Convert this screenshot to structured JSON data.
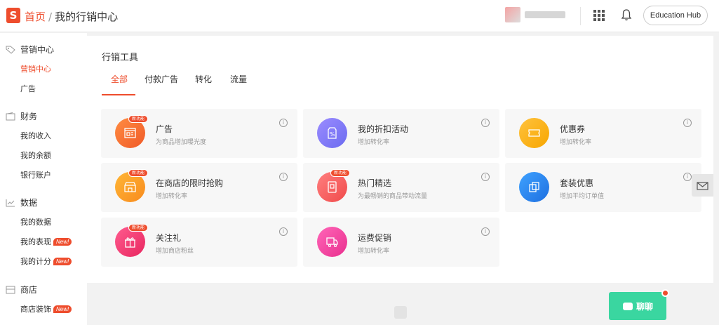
{
  "header": {
    "logo_letter": "S",
    "breadcrumb_home": "首页",
    "breadcrumb_sep": "/",
    "breadcrumb_current": "我的行销中心",
    "edu_hub_label": "Education Hub"
  },
  "sidebar": {
    "sections": [
      {
        "title": "营销中心",
        "icon": "tag-icon",
        "items": [
          {
            "label": "营销中心",
            "active": true
          },
          {
            "label": "广告"
          }
        ]
      },
      {
        "title": "财务",
        "icon": "wallet-icon",
        "items": [
          {
            "label": "我的收入"
          },
          {
            "label": "我的余额"
          },
          {
            "label": "银行账户"
          }
        ]
      },
      {
        "title": "数据",
        "icon": "chart-icon",
        "items": [
          {
            "label": "我的数据"
          },
          {
            "label": "我的表现",
            "badge": "New!"
          },
          {
            "label": "我的计分",
            "badge": "New!"
          }
        ]
      },
      {
        "title": "商店",
        "icon": "shop-icon",
        "items": [
          {
            "label": "商店装饰",
            "badge": "New!"
          }
        ]
      }
    ]
  },
  "main": {
    "title": "行销工具",
    "tabs": [
      "全部",
      "付款广告",
      "转化",
      "流量"
    ],
    "cards": [
      {
        "title": "广告",
        "desc": "为商品增加曝光度",
        "badge": "新功能",
        "color": "#f26b35",
        "icon": "ads-icon"
      },
      {
        "title": "我的折扣活动",
        "desc": "增加转化率",
        "color": "#7f7af5",
        "icon": "discount-icon"
      },
      {
        "title": "优惠券",
        "desc": "增加转化率",
        "color": "#fbb21f",
        "icon": "voucher-icon"
      },
      {
        "title": "在商店的限时抢购",
        "desc": "增加转化率",
        "badge": "新功能",
        "color": "#fb9d2b",
        "icon": "flash-sale-icon"
      },
      {
        "title": "热门精选",
        "desc": "为最畅销的商品带动流量",
        "badge": "新功能",
        "color": "#f45f5f",
        "icon": "top-picks-icon"
      },
      {
        "title": "套装优惠",
        "desc": "增加平均订单值",
        "color": "#2f89f2",
        "icon": "bundle-icon"
      },
      {
        "title": "关注礼",
        "desc": "增加商店粉丝",
        "badge": "新功能",
        "color": "#f23f74",
        "icon": "gift-icon"
      },
      {
        "title": "运费促销",
        "desc": "增加转化率",
        "color": "#f548a1",
        "icon": "shipping-icon"
      }
    ]
  },
  "chat": {
    "label": "聊聊"
  },
  "colors": {
    "accent": "#ee4d2d",
    "chat": "#3ad6a0"
  }
}
